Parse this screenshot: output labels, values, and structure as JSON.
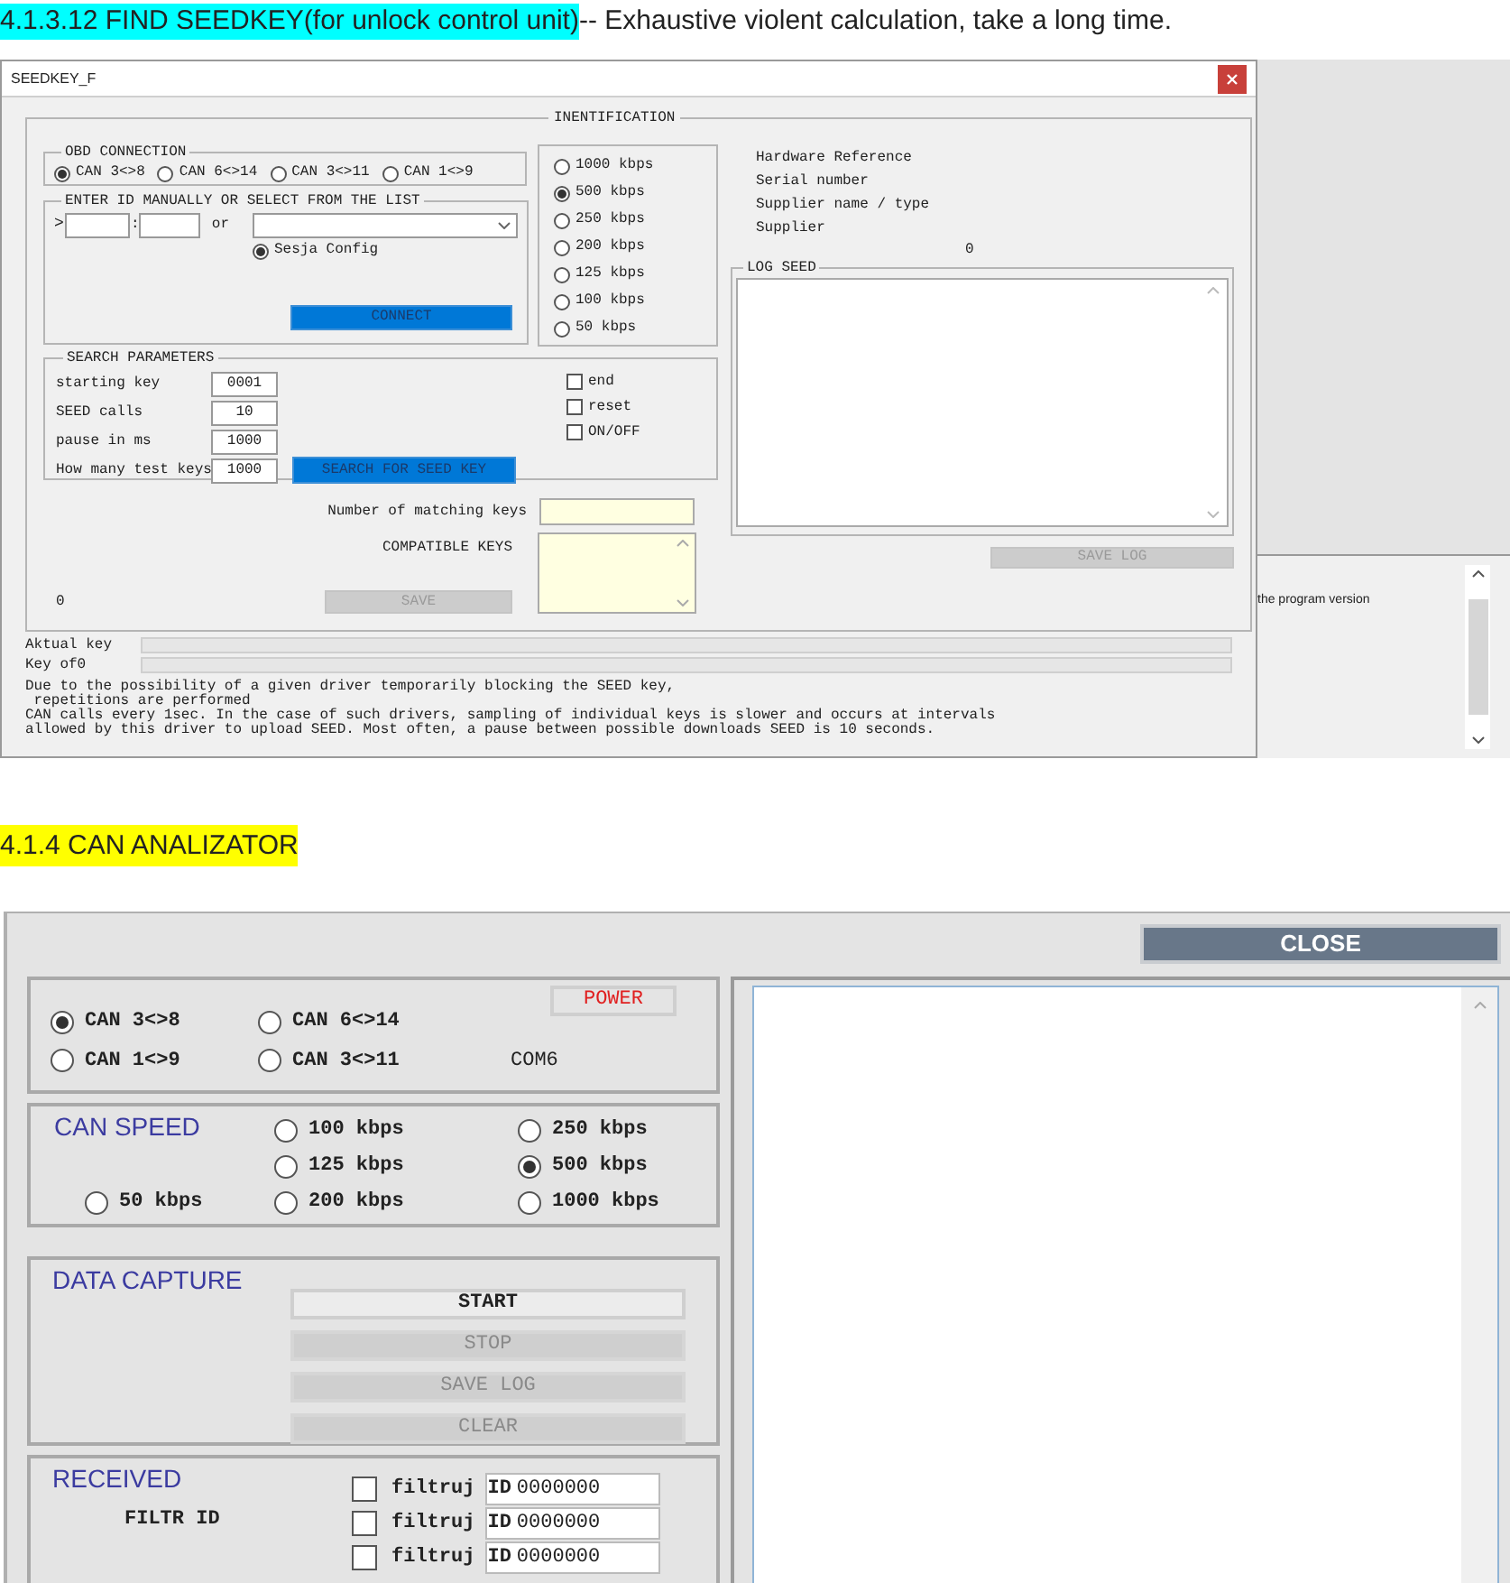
{
  "section_1": {
    "heading": "4.1.3.12 FIND SEEDKEY(for unlock control unit)",
    "note": "-- Exhaustive violent calculation, take a long time."
  },
  "seedkey_window": {
    "title": "SEEDKEY_F",
    "identification_label": "INENTIFICATION",
    "obd_connection": {
      "label": "OBD CONNECTION",
      "options": [
        {
          "label": "CAN 3<>8",
          "selected": true
        },
        {
          "label": "CAN 6<>14",
          "selected": false
        },
        {
          "label": "CAN 3<>11",
          "selected": false
        },
        {
          "label": "CAN 1<>9",
          "selected": false
        }
      ]
    },
    "enter_id": {
      "label": "ENTER ID MANUALLY OR SELECT FROM THE LIST",
      "prompt": ">",
      "separator": ":",
      "or_label": "or",
      "config_option": {
        "label": "Sesja Config",
        "selected": true
      },
      "connect_button": "CONNECT"
    },
    "speeds": [
      {
        "label": "1000 kbps",
        "selected": false
      },
      {
        "label": "500 kbps",
        "selected": true
      },
      {
        "label": "250 kbps",
        "selected": false
      },
      {
        "label": "200 kbps",
        "selected": false
      },
      {
        "label": "125 kbps",
        "selected": false
      },
      {
        "label": "100 kbps",
        "selected": false
      },
      {
        "label": "50 kbps",
        "selected": false
      }
    ],
    "info_labels": [
      "Hardware Reference",
      "Serial number",
      "Supplier name / type",
      "Supplier"
    ],
    "info_value": "0",
    "log_seed": {
      "label": "LOG SEED",
      "save_button": {
        "label": "SAVE LOG",
        "disabled": true
      }
    },
    "search_parameters": {
      "label": "SEARCH PARAMETERS",
      "fields": [
        {
          "label": "starting key",
          "value": "0001"
        },
        {
          "label": "SEED calls",
          "value": "10"
        },
        {
          "label": "pause in ms",
          "value": "1000"
        },
        {
          "label": "How many test keys",
          "value": "1000"
        }
      ],
      "search_button": "SEARCH FOR SEED KEY",
      "options": [
        {
          "label": "end",
          "checked": false
        },
        {
          "label": "reset",
          "checked": false
        },
        {
          "label": "ON/OFF",
          "checked": false
        }
      ]
    },
    "matching_keys_label": "Number of matching keys",
    "compatible_keys_label": "COMPATIBLE KEYS",
    "counter": "0",
    "save_button": {
      "label": "SAVE",
      "disabled": true
    },
    "progress": [
      {
        "label": "Aktual key",
        "level": 0
      },
      {
        "label": "Key of0",
        "level": 0
      }
    ],
    "note": "Due to the possibility of a given driver temporarily blocking the SEED key,\n repetitions are performed\nCAN calls every 1sec. In the case of such drivers, sampling of individual keys is slower and occurs at intervals\nallowed by this driver to upload SEED. Most often, a pause between possible downloads SEED is 10 seconds."
  },
  "background_window": {
    "text": "the program version"
  },
  "section_2": {
    "heading": "4.1.4 CAN ANALIZATOR"
  },
  "can_analyzer_window": {
    "close_button": "CLOSE",
    "connection": {
      "options": [
        {
          "label": "CAN 3<>8",
          "selected": true
        },
        {
          "label": "CAN 6<>14",
          "selected": false
        },
        {
          "label": "CAN 1<>9",
          "selected": false
        },
        {
          "label": "CAN 3<>11",
          "selected": false
        }
      ],
      "power_button": "POWER",
      "port": "COM6"
    },
    "can_speed": {
      "title": "CAN SPEED",
      "options": [
        {
          "label": "100 kbps",
          "selected": false
        },
        {
          "label": "250 kbps",
          "selected": false
        },
        {
          "label": "125 kbps",
          "selected": false
        },
        {
          "label": "500 kbps",
          "selected": true
        },
        {
          "label": "50 kbps",
          "selected": false
        },
        {
          "label": "200 kbps",
          "selected": false
        },
        {
          "label": "1000 kbps",
          "selected": false
        }
      ]
    },
    "data_capture": {
      "title": "DATA CAPTURE",
      "buttons": [
        {
          "label": "START",
          "disabled": false
        },
        {
          "label": "STOP",
          "disabled": true
        },
        {
          "label": "SAVE LOG",
          "disabled": true
        },
        {
          "label": "CLEAR",
          "disabled": true
        }
      ]
    },
    "received": {
      "title": "RECEIVED",
      "filter_label": "FILTR ID",
      "filters": [
        {
          "label": "filtruj",
          "prefix": "ID",
          "value": "0000000",
          "checked": false
        },
        {
          "label": "filtruj",
          "prefix": "ID",
          "value": "0000000",
          "checked": false
        },
        {
          "label": "filtruj",
          "prefix": "ID",
          "value": "0000000",
          "checked": false
        }
      ]
    }
  }
}
